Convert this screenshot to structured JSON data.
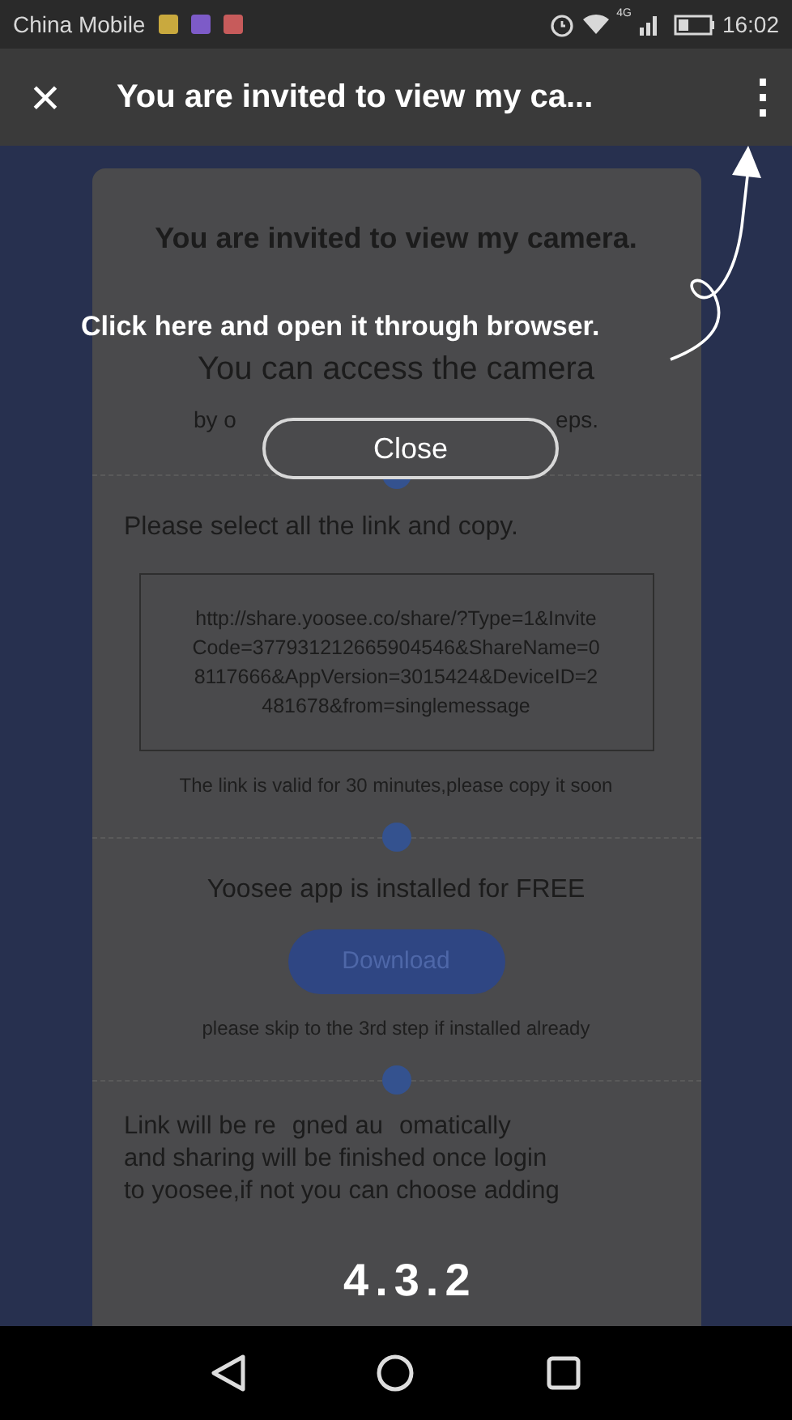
{
  "status_bar": {
    "carrier": "China Mobile",
    "network": "4G",
    "time": "16:02"
  },
  "title_bar": {
    "close": "×",
    "title": "You are invited to view my ca...",
    "menu": "⋮"
  },
  "card": {
    "heading": "You are invited to view my camera.",
    "subheading": "You can access the camera",
    "subheading_left": "by o",
    "subheading_right": "eps.",
    "steps": [
      {
        "kind": "link",
        "instruction": "Please select all the link and copy.",
        "link": "http://share.yoosee.co/share/?Type=1&InviteCode=377931212665904546&ShareName=08117666&AppVersion=3015424&DeviceID=2481678&from=singlemessage",
        "note": "The link is valid for 30 minutes,please copy it soon"
      },
      {
        "kind": "download",
        "instruction": "Yoosee app is installed for FREE",
        "button": "Download",
        "note": "please skip to the 3rd step if installed already"
      },
      {
        "kind": "text",
        "lines": [
          [
            "Link will be re",
            "gned au",
            "omatically"
          ],
          [
            "and sharing will be finished once login"
          ],
          [
            "to yoosee,if not you can choose adding"
          ]
        ]
      }
    ]
  },
  "overlay": {
    "hint": "Click here and open it through browser.",
    "close_button": "Close",
    "caption": "4.3.2"
  }
}
